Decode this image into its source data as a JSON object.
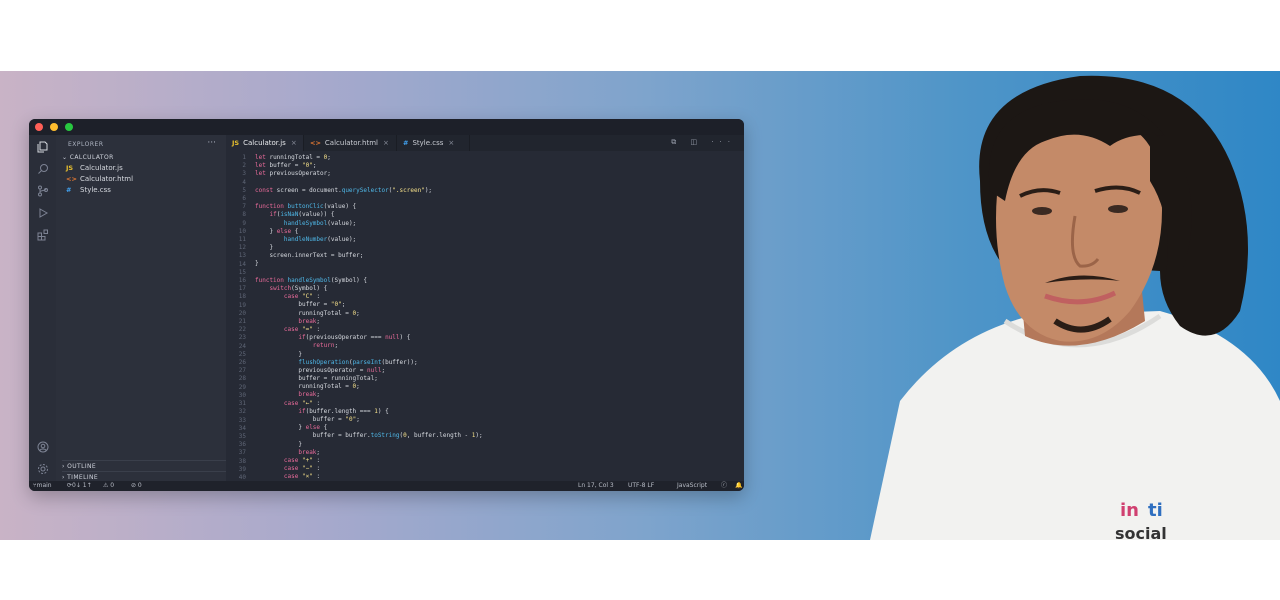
{
  "window": {
    "traffic_lights": {
      "close": "#fe5f57",
      "minimize": "#febc2e",
      "maximize": "#28c840"
    }
  },
  "activity_bar": {
    "icons": [
      "files-icon",
      "search-icon",
      "source-control-icon",
      "run-debug-icon",
      "extensions-icon",
      "account-icon",
      "settings-gear-icon"
    ]
  },
  "sidebar": {
    "header": "EXPLORER",
    "more": "···",
    "folder": "CALCULATOR",
    "files": [
      {
        "icon": "JS",
        "name": "Calculator.js"
      },
      {
        "icon": "<>",
        "name": "Calculator.html"
      },
      {
        "icon": "#",
        "name": "Style.css"
      }
    ],
    "outline": "OUTLINE",
    "timeline": "TIMELINE"
  },
  "tabs": [
    {
      "icon": "JS",
      "label": "Calculator.js",
      "close": "×"
    },
    {
      "icon": "<>",
      "label": "Calculator.html",
      "close": "×"
    },
    {
      "icon": "#",
      "label": "Style.css",
      "close": "×"
    }
  ],
  "tab_actions": "⧉ ◫ ···",
  "code_lines": [
    "let runningTotal = 0;",
    "let buffer = \"0\";",
    "let previousOperator;",
    "",
    "const screen = document.querySelector(\".screen\");",
    "",
    "function buttonClic(value) {",
    "    if(isNaN(value)) {",
    "        handleSymbol(value);",
    "    } else {",
    "        handleNumber(value);",
    "    }",
    "    screen.innerText = buffer;",
    "}",
    "",
    "function handleSymbol(Symbol) {",
    "    switch(Symbol) {",
    "        case \"C\" :",
    "            buffer = \"0\";",
    "            runningTotal = 0;",
    "            break;",
    "        case \"=\" :",
    "            if(previousOperator === null) {",
    "                return;",
    "            }",
    "            flushOperation(parseInt(buffer));",
    "            previousOperator = null;",
    "            buffer = runningTotal;",
    "            runningTotal = 0;",
    "            break;",
    "        case \"←\" :",
    "            if(buffer.length === 1) {",
    "                buffer = \"0\";",
    "            } else {",
    "                buffer = buffer.toString(0, buffer.length - 1);",
    "            }",
    "            break;",
    "        case \"+\" :",
    "        case \"−\" :",
    "        case \"×\" :"
  ],
  "status": {
    "branch": "main",
    "sync": "0↓ 1↑",
    "warnings": "⚠ 0",
    "errors": "⊘ 0",
    "position": "Ln 17, Col 3",
    "encoding": "UTF-8  LF",
    "language": "JavaScript"
  }
}
